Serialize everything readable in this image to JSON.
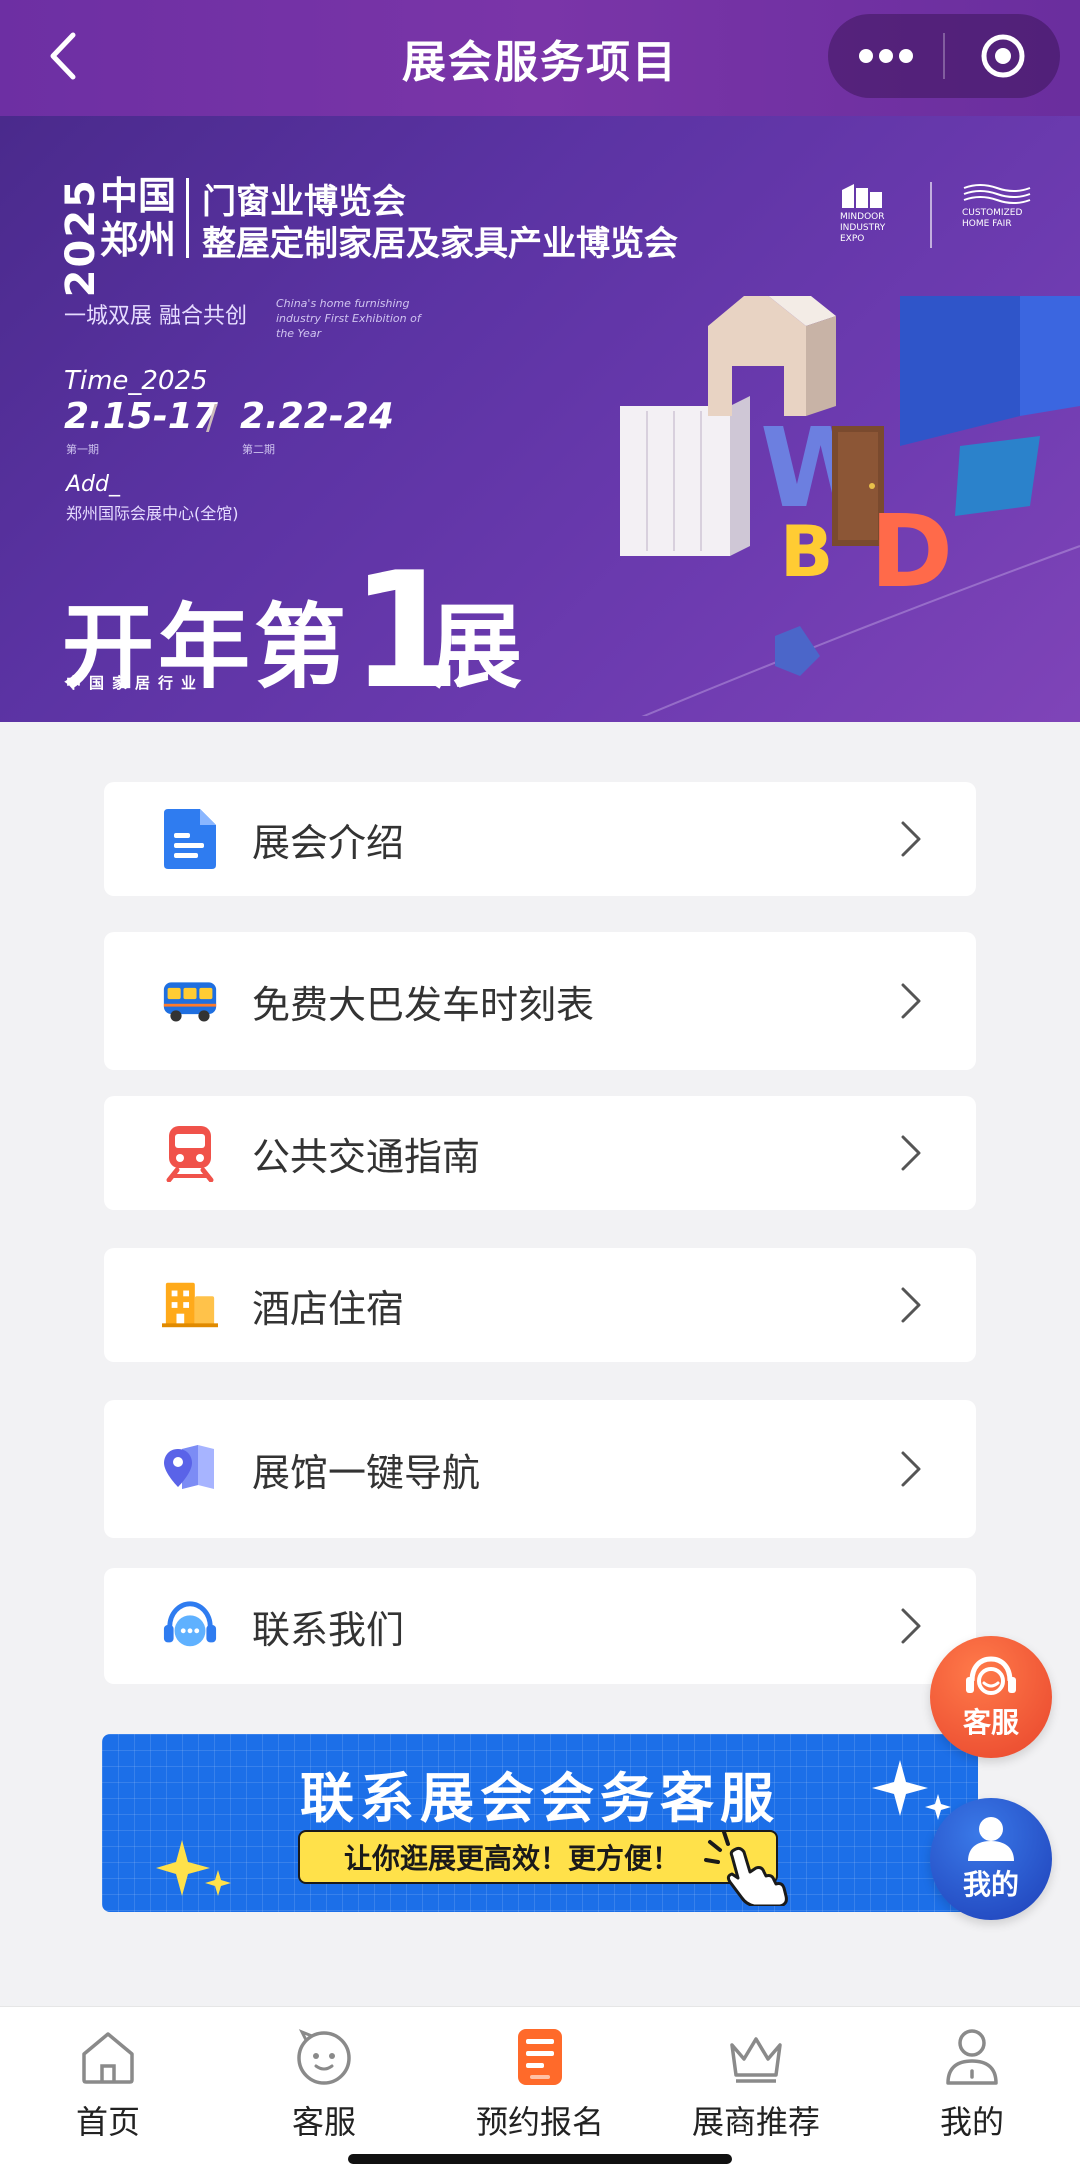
{
  "header": {
    "title": "展会服务项目"
  },
  "banner": {
    "year": "2025",
    "city": "中国郑州",
    "title_line1": "门窗业博览会",
    "title_line2": "整屋定制家居及家具产业博览会",
    "slogan": "一城双展 融合共创",
    "english_tagline": "China's home furnishing industry First Exhibition of the Year",
    "time_label": "Time_2025",
    "date1": "2.15-17",
    "date1_sub": "第一期",
    "date2": "2.22-24",
    "date2_sub": "第二期",
    "add_label": "Add_",
    "address": "郑州国际会展中心(全馆)",
    "big_pre": "开年第",
    "big_num": "1",
    "big_post": "展",
    "big_sub": "中国家居行业",
    "logo1_text": "MINDOOR INDUSTRY EXPO",
    "logo2_text": "CUSTOMIZED HOME FAIR"
  },
  "menu": [
    {
      "label": "展会介绍",
      "icon": "document-icon"
    },
    {
      "label": "免费大巴发车时刻表",
      "icon": "bus-icon"
    },
    {
      "label": "公共交通指南",
      "icon": "train-icon"
    },
    {
      "label": "酒店住宿",
      "icon": "hotel-icon"
    },
    {
      "label": "展馆一键导航",
      "icon": "map-pin-icon"
    },
    {
      "label": "联系我们",
      "icon": "headset-chat-icon"
    }
  ],
  "service_banner": {
    "title": "联系展会会务客服",
    "subtitle": "让你逛展更高效！更方便！"
  },
  "fabs": {
    "customer_service": "客服",
    "mine": "我的"
  },
  "tabs": [
    {
      "label": "首页",
      "icon": "home-icon"
    },
    {
      "label": "客服",
      "icon": "chat-face-icon"
    },
    {
      "label": "预约报名",
      "icon": "register-icon"
    },
    {
      "label": "展商推荐",
      "icon": "crown-icon"
    },
    {
      "label": "我的",
      "icon": "user-icon"
    }
  ],
  "colors": {
    "header": "#7a35a8",
    "active_tab": "#ff6a2a",
    "service_blue": "#1c6fe8"
  }
}
